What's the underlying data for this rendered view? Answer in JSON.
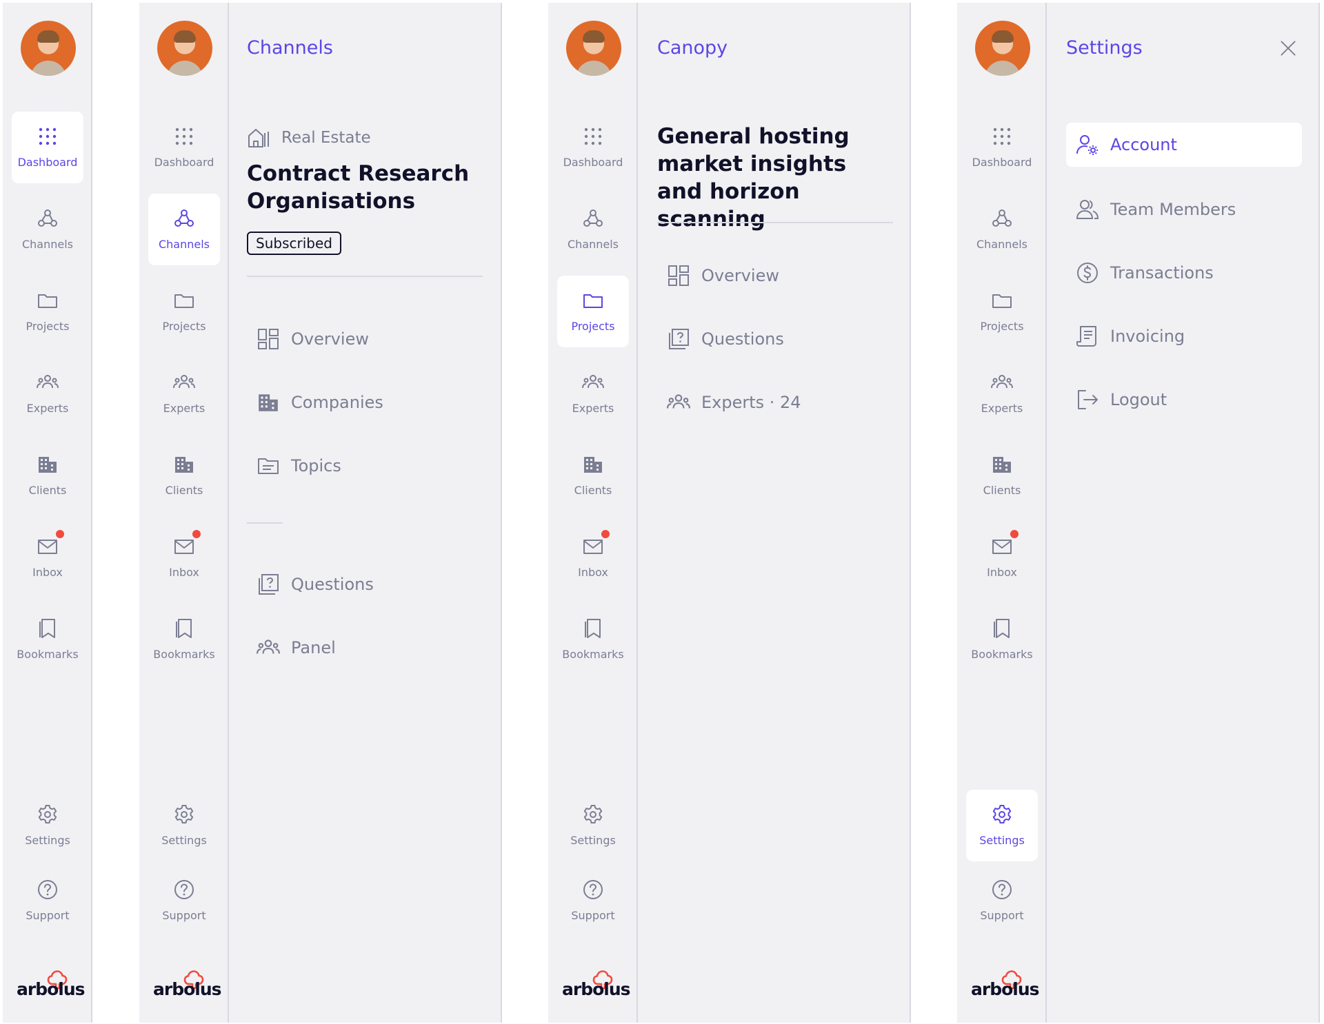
{
  "nav": {
    "dashboard": "Dashboard",
    "channels": "Channels",
    "projects": "Projects",
    "experts": "Experts",
    "clients": "Clients",
    "inbox": "Inbox",
    "bookmarks": "Bookmarks",
    "settings": "Settings",
    "support": "Support"
  },
  "brand": {
    "logo_text": "arbolus",
    "accent": "#5b46e5",
    "logo_accent": "#f04b3e",
    "text_dark": "#111229",
    "muted": "#7b7d92"
  },
  "channels_panel": {
    "title": "Channels",
    "category": "Real Estate",
    "heading": "Contract Research Organisations",
    "badge": "Subscribed",
    "items": [
      "Overview",
      "Companies",
      "Topics"
    ],
    "items2": [
      "Questions",
      "Panel"
    ]
  },
  "canopy_panel": {
    "title": "Canopy",
    "heading": "General hosting market insights and horizon scanning",
    "items": [
      "Overview",
      "Questions",
      "Experts · 24"
    ]
  },
  "settings_panel": {
    "title": "Settings",
    "items": [
      "Account",
      "Team Members",
      "Transactions",
      "Invoicing",
      "Logout"
    ]
  }
}
